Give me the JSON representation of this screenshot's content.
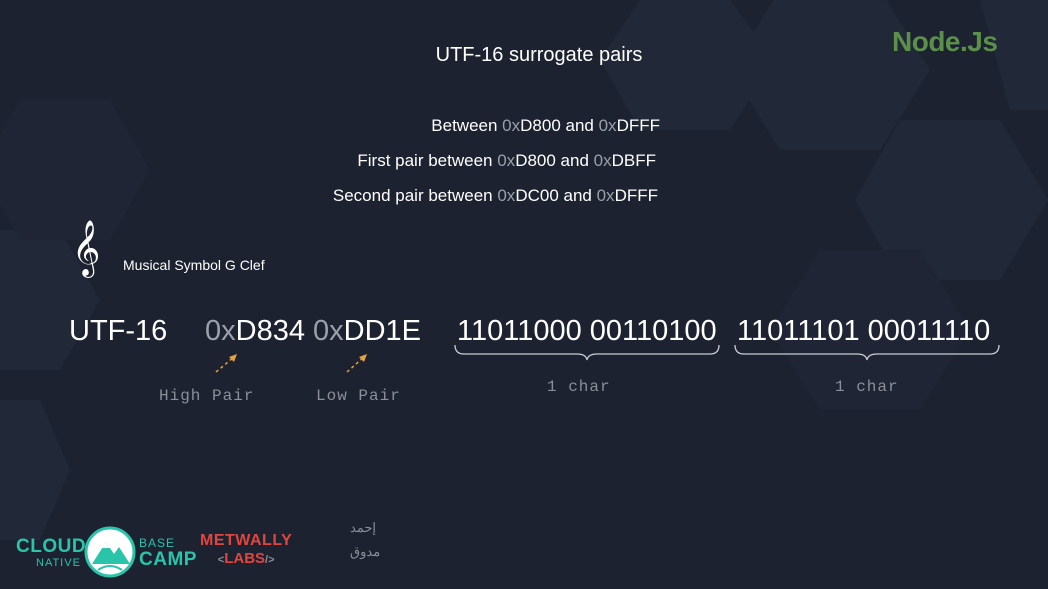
{
  "slide": {
    "title": "UTF-16 surrogate pairs",
    "brand": "Node.Js"
  },
  "ranges": [
    {
      "prefix": "Between ",
      "a_hex": "0x",
      "a_val": "D800",
      "mid": " and ",
      "b_hex": "0x",
      "b_val": "DFFF"
    },
    {
      "prefix": "First pair between ",
      "a_hex": "0x",
      "a_val": "D800",
      "mid": " and ",
      "b_hex": "0x",
      "b_val": "DBFF"
    },
    {
      "prefix": "Second pair between ",
      "a_hex": "0x",
      "a_val": "DC00",
      "mid": " and ",
      "b_hex": "0x",
      "b_val": "DFFF"
    }
  ],
  "symbol": {
    "glyph": "𝄞",
    "label": "Musical Symbol G Clef"
  },
  "encoding": {
    "label": "UTF-16",
    "high_prefix": "0x",
    "high_value": "D834",
    "low_prefix": "0x",
    "low_value": "DD1E",
    "high_bits": "11011000 00110100",
    "low_bits": "11011101 00011110",
    "high_caption": "High Pair",
    "low_caption": "Low Pair",
    "char_caption_1": "1 char",
    "char_caption_2": "1 char"
  },
  "logos": {
    "cloud_1": "CLOUD",
    "cloud_2": "NATIVE",
    "cloud_3": "BASE",
    "cloud_4": "CAMP",
    "metwally_1": "METWALLY",
    "metwally_2": "LABS",
    "metwally_lt": "<",
    "metwally_gt": "/>",
    "arabic_1": "إحمد",
    "arabic_2": "مدوق"
  },
  "colors": {
    "background": "#1c2230",
    "brand_green": "#5b8f4a",
    "dim_text": "#9aa0aa",
    "arrow_orange": "#e8a23a",
    "teal": "#29c4a9",
    "red": "#e0453e"
  }
}
